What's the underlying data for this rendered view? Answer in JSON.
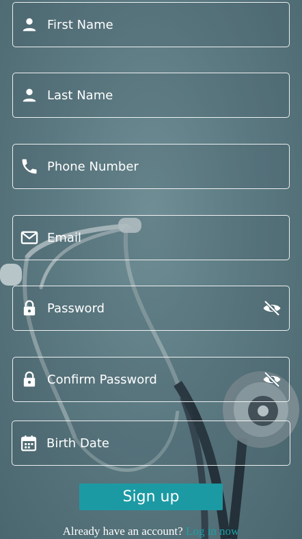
{
  "fields": [
    {
      "name": "first-name",
      "placeholder": "First Name",
      "icon": "person-icon",
      "value": ""
    },
    {
      "name": "last-name",
      "placeholder": "Last Name",
      "icon": "person-icon",
      "value": ""
    },
    {
      "name": "phone-number",
      "placeholder": "Phone Number",
      "icon": "phone-icon",
      "value": ""
    },
    {
      "name": "email",
      "placeholder": "Email",
      "icon": "mail-icon",
      "value": ""
    },
    {
      "name": "password",
      "placeholder": "Password",
      "icon": "lock-icon",
      "value": "",
      "trailing_icon": "eye-off-icon"
    },
    {
      "name": "confirm-password",
      "placeholder": "Confirm Password",
      "icon": "lock-icon",
      "value": "",
      "trailing_icon": "eye-off-icon"
    },
    {
      "name": "birth-date",
      "placeholder": "Birth Date",
      "icon": "calendar-icon",
      "value": ""
    }
  ],
  "signup_button": {
    "label": "Sign up"
  },
  "footer": {
    "prompt": "Already have an account?",
    "link": "Log in now"
  },
  "colors": {
    "accent": "#1c9aa4",
    "link": "#1ca0a8",
    "background": "#4e6a72",
    "text": "#ffffff"
  }
}
